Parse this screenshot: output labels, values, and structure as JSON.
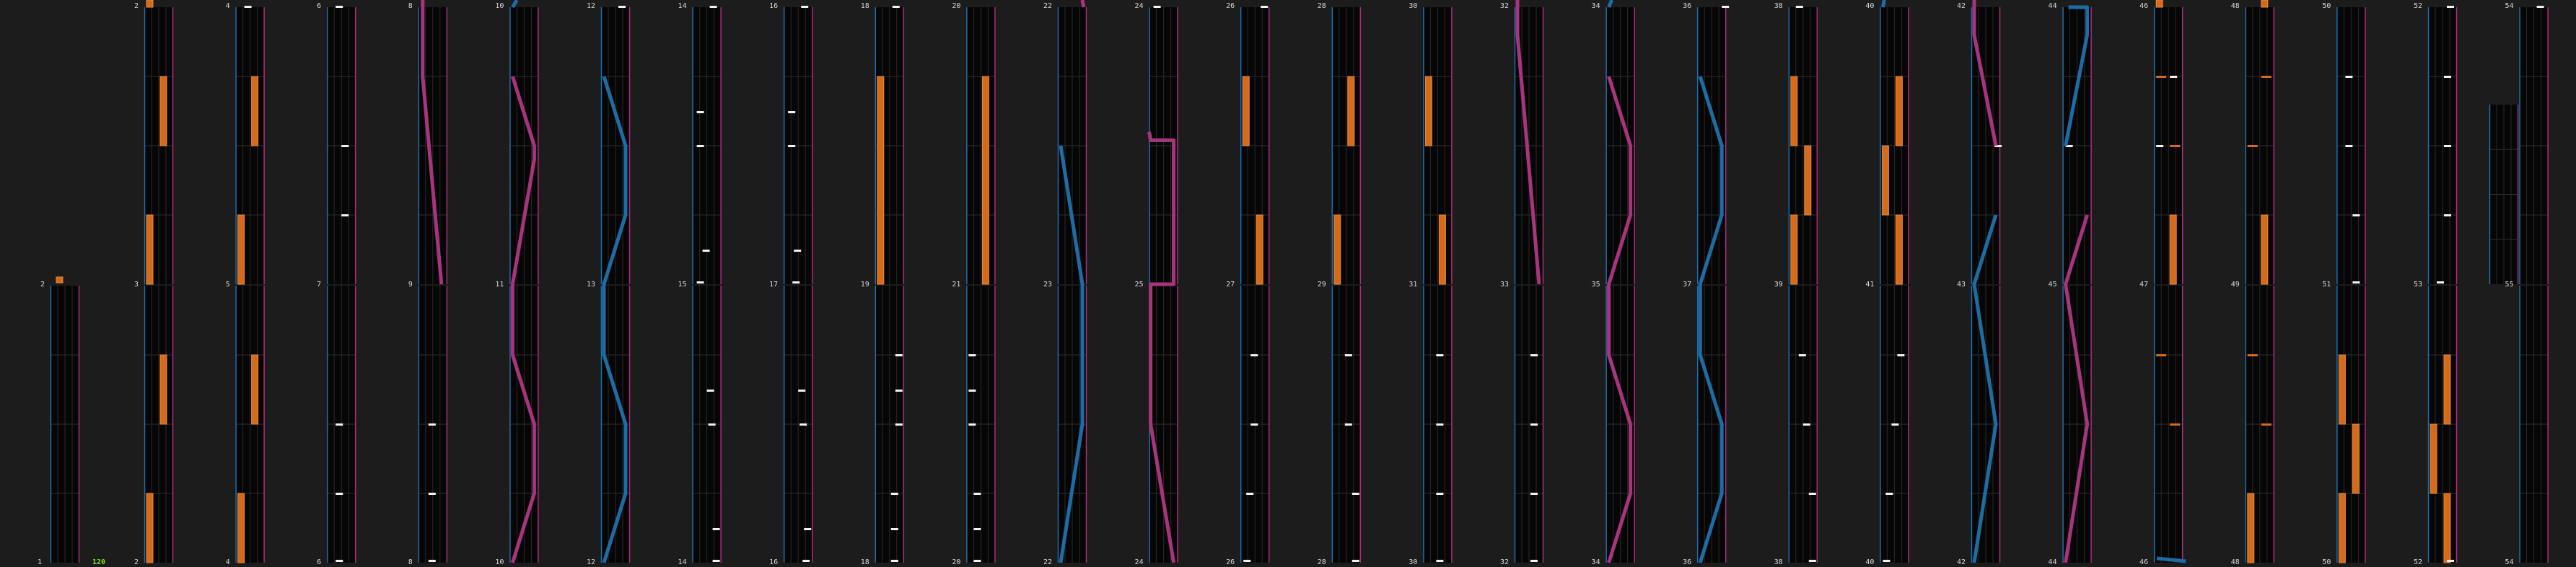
{
  "colors": {
    "background": "#1c1c1c",
    "lane_bg": "#060606",
    "lane_edge_blue": "#1c6fb0",
    "lane_edge_pink": "#b02a80",
    "lane_divider": "#2a2a2a",
    "row_grid": "#2f2f2f",
    "hold_orange": "#d46a1c",
    "hold_orange_light": "#e88a3c",
    "tap_white": "#f2f2f2",
    "slide_pink": "#a8347e",
    "slide_blue": "#1e6ca4",
    "bpm_green": "#7fe01e"
  },
  "bpm_marker": "120",
  "top_row_numbers": [
    "2",
    "4",
    "6",
    "8",
    "10",
    "12",
    "14",
    "16",
    "18",
    "20",
    "22",
    "24",
    "26",
    "28",
    "30",
    "32",
    "34",
    "36",
    "38",
    "40",
    "42",
    "44",
    "46",
    "48",
    "50",
    "52",
    "54"
  ],
  "top_row_lower_numbers": [
    "3",
    "5",
    "7",
    "9",
    "11",
    "13",
    "15",
    "17",
    "19",
    "21",
    "23",
    "25",
    "27",
    "29",
    "31",
    "33",
    "35",
    "37",
    "39",
    "41",
    "43",
    "45",
    "47",
    "49",
    "51",
    "53",
    "55"
  ],
  "bottom_row_numbers": [
    "1",
    "2",
    "4",
    "6",
    "8",
    "10",
    "12",
    "14",
    "16",
    "18",
    "20",
    "22",
    "24",
    "26",
    "28",
    "30",
    "32",
    "34",
    "36",
    "38",
    "40",
    "42",
    "44",
    "46",
    "48",
    "50",
    "52",
    "54"
  ]
}
